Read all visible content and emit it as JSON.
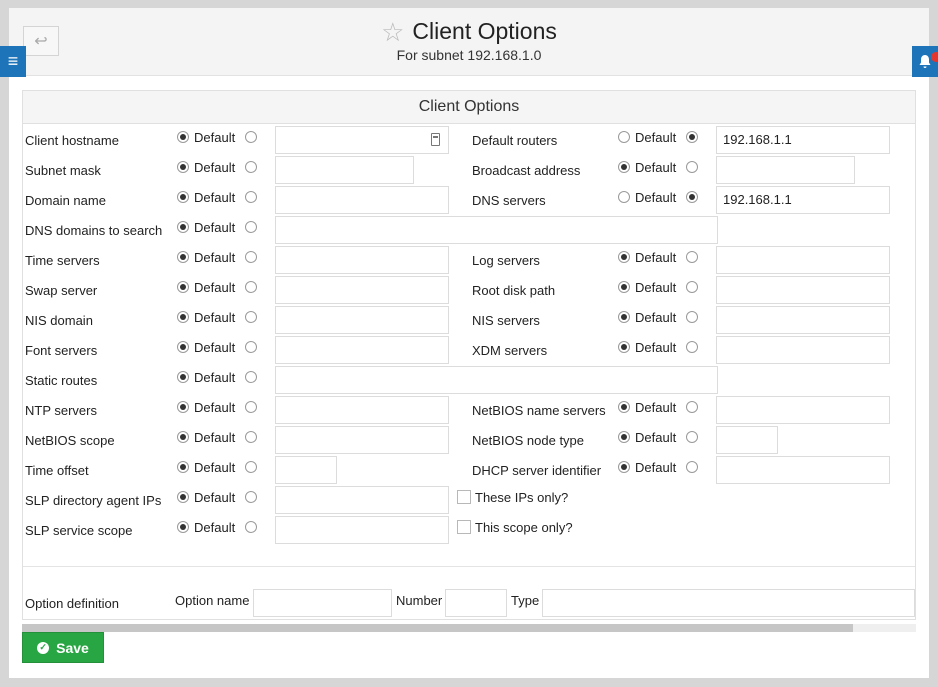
{
  "page": {
    "title": "Client Options",
    "subtitle": "For subnet 192.168.1.0",
    "back_icon": "↩",
    "menu_icon": "≡",
    "bell_icon": "bell"
  },
  "panel": {
    "title": "Client Options"
  },
  "labels": {
    "default": "Default"
  },
  "left": [
    {
      "label": "Client hostname",
      "default_on": true,
      "value": ""
    },
    {
      "label": "Subnet mask",
      "default_on": true,
      "value": ""
    },
    {
      "label": "Domain name",
      "default_on": true,
      "value": ""
    },
    {
      "label": "DNS domains to search",
      "default_on": true,
      "value": ""
    },
    {
      "label": "Time servers",
      "default_on": true,
      "value": ""
    },
    {
      "label": "Swap server",
      "default_on": true,
      "value": ""
    },
    {
      "label": "NIS domain",
      "default_on": true,
      "value": ""
    },
    {
      "label": "Font servers",
      "default_on": true,
      "value": ""
    },
    {
      "label": "Static routes",
      "default_on": true,
      "value": ""
    },
    {
      "label": "NTP servers",
      "default_on": true,
      "value": ""
    },
    {
      "label": "NetBIOS scope",
      "default_on": true,
      "value": ""
    },
    {
      "label": "Time offset",
      "default_on": true,
      "value": ""
    },
    {
      "label": "SLP directory agent IPs",
      "default_on": true,
      "value": ""
    },
    {
      "label": "SLP service scope",
      "default_on": true,
      "value": ""
    }
  ],
  "right": [
    {
      "label": "Default routers",
      "default_on": false,
      "value": "192.168.1.1"
    },
    {
      "label": "Broadcast address",
      "default_on": true,
      "value": ""
    },
    {
      "label": "DNS servers",
      "default_on": false,
      "value": "192.168.1.1"
    },
    {
      "label": "Log servers",
      "default_on": true,
      "value": ""
    },
    {
      "label": "Root disk path",
      "default_on": true,
      "value": ""
    },
    {
      "label": "NIS servers",
      "default_on": true,
      "value": ""
    },
    {
      "label": "XDM servers",
      "default_on": true,
      "value": ""
    },
    {
      "label": "NetBIOS name servers",
      "default_on": true,
      "value": ""
    },
    {
      "label": "NetBIOS node type",
      "default_on": true,
      "value": ""
    },
    {
      "label": "DHCP server identifier",
      "default_on": true,
      "value": ""
    }
  ],
  "checkboxes": {
    "ips_only": "These IPs only?",
    "scope_only": "This scope only?"
  },
  "option_definition": {
    "label": "Option definition",
    "name_label": "Option name",
    "number_label": "Number",
    "type_label": "Type"
  },
  "save_label": "Save"
}
